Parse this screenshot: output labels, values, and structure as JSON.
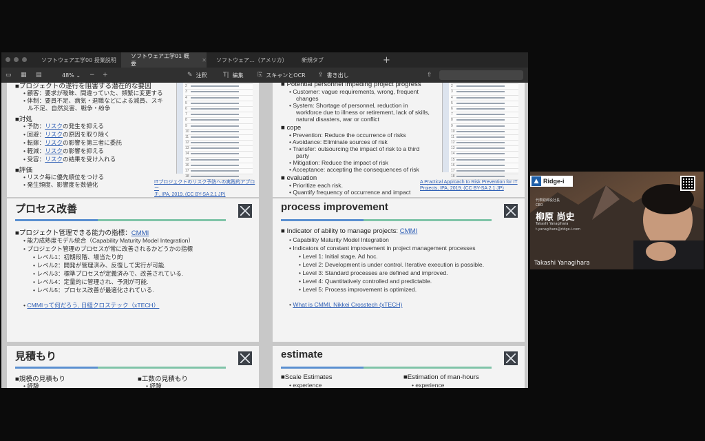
{
  "tabs": [
    {
      "label": "ソフトウェア工学00 授業説明",
      "active": false
    },
    {
      "label": "ソフトウェア工学01 概要",
      "active": true
    },
    {
      "label": "ソフトウェア…（アメリカ）",
      "active": false
    },
    {
      "label": "新規タブ",
      "active": false
    }
  ],
  "toolbar": {
    "zoom": "48%",
    "annotate": "注釈",
    "edit": "編集",
    "scan_ocr": "スキャンとOCR",
    "export": "書き出し"
  },
  "slides": {
    "top_left": {
      "l0": "■プロジェクトの遂行を阻害する潜在的な要因",
      "l1": "• 顧客：要求が曖昧、間違っていた、頻繁に変更する",
      "l2": "• 体制：要員不足、病気・退職などによる減員、スキ",
      "l3": "ル不足、自然災害、戦争・紛争",
      "l4": "■対処",
      "l5a": "• 予防：",
      "l5b": "リスク",
      "l5c": "の発生を抑える",
      "l6a": "• 回避：",
      "l6b": "リスク",
      "l6c": "の原因を取り除く",
      "l7a": "• 転嫁：",
      "l7b": "リスク",
      "l7c": "の影響を第三者に委託",
      "l8a": "• 軽減：",
      "l8b": "リスク",
      "l8c": "の影響を抑える",
      "l9a": "• 受容：",
      "l9b": "リスク",
      "l9c": "の結果を受け入れる",
      "l10": "■評価",
      "l11": "• リスク毎に優先順位をつける",
      "l12": "• 発生頻度、影響度を数値化",
      "cite1": "ITプロジェクトのリスク予防への実践的アプロー",
      "cite2": "チ, IPA, 2019. (CC BY-SA 2.1 JP)"
    },
    "top_right": {
      "l0": "■ Potential personnel impeding project progress",
      "l1": "• Customer: vague requirements, wrong, frequent",
      "l2": "changes",
      "l3": "• System: Shortage of personnel, reduction in",
      "l4": "workforce due to illness or retirement, lack of skills,",
      "l5": "natural disasters, war or conflict",
      "l6": "■ cope",
      "l7": "• Prevention: Reduce the occurrence of risks",
      "l8": "• Avoidance: Eliminate sources of risk",
      "l9": "• Transfer: outsourcing the impact of risk to a third",
      "l10": "party",
      "l11": "• Mitigation: Reduce the impact of risk",
      "l12": "• Acceptance: accepting the consequences of risk",
      "l13": "■ evaluation",
      "l14": "• Prioritize each risk.",
      "l15": "• Quantify frequency of occurrence and impact",
      "cite1": "A Practical Approach to Risk Prevention for IT",
      "cite2": "Projects, IPA, 2019. (CC BY-SA 2.1 JP)"
    },
    "mid_left": {
      "title": "プロセス改善",
      "l0a": "■プロジェクト管理できる能力の指標：",
      "l0b": "CMMI",
      "l1": "• 能力成熟度モデル統合（Capability Maturity Model Integration）",
      "l2": "• プロジェクト管理のプロセスが常に改善されるかどうかの指標",
      "l3": "• レベル1：初期段階、場当たり的",
      "l4": "• レベル2：開発が管理済み、反復して実行が可能.",
      "l5": "• レベル3：標準プロセスが定義済みで、改善されている.",
      "l6": "• レベル4：定量的に管理され、予測が可能.",
      "l7": "• レベル5：プロセス改善が最適化されている.",
      "link": "CMMIって何だろう, 日経クロステック（xTECH）"
    },
    "mid_right": {
      "title": "process improvement",
      "l0a": "■ Indicator of ability to manage projects: ",
      "l0b": "CMMI",
      "l1": "• Capability Maturity Model Integration",
      "l2": "• Indicators of constant improvement in project management processes",
      "l3": "• Level 1: Initial stage. Ad hoc.",
      "l4": "• Level 2: Development is under control. Iterative execution is possible.",
      "l5": "• Level 3: Standard processes are defined and improved.",
      "l6": "• Level 4: Quantitatively controlled and predictable.",
      "l7": "• Level 5: Process improvement is optimized.",
      "link": "What is CMMI, Nikkei Crosstech (xTECH)"
    },
    "bot_left": {
      "title": "見積もり",
      "c1": "■規模の見積もり",
      "c1s": "• 経験",
      "c2": "■工数の見積もり",
      "c2s": "• 経験"
    },
    "bot_right": {
      "title": "estimate",
      "c1": "■Scale Estimates",
      "c1s": "• experience",
      "c2": "■Estimation of man-hours",
      "c2s": "• experience"
    }
  },
  "video": {
    "brand": "Ridge-i",
    "role1": "代表取締役社長",
    "role2": "CEO",
    "name_jp": "柳原 尚史",
    "name_en_small": "Takashi Yanagihara",
    "email": "t.yanagihara@ridge-i.com",
    "participant_name": "Takashi Yanagihara"
  },
  "colors": {
    "link": "#2f5fb5",
    "accent_blue": "#5a8fd0",
    "accent_green": "#7fc4a8"
  }
}
